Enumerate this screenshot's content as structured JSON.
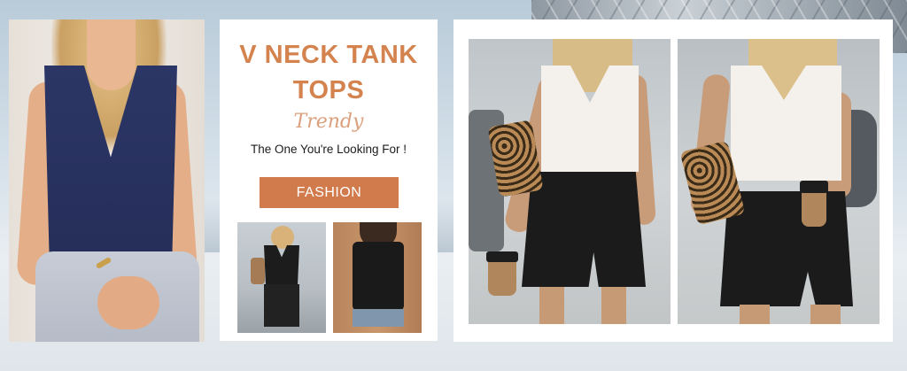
{
  "banner": {
    "title": "V NECK TANK TOPS",
    "script_word": "Trendy",
    "tagline": "The One You're Looking For !",
    "button_label": "FASHION"
  },
  "colors": {
    "accent": "#d4834e",
    "button": "#d17b4c",
    "top_navy": "#2c3666",
    "top_white": "#f4f1ec",
    "top_black": "#1e1e1e",
    "skirt_black": "#1b1b1b"
  },
  "images": [
    {
      "name": "model-navy-tank-photo"
    },
    {
      "name": "thumbnail-black-tank-front"
    },
    {
      "name": "thumbnail-black-tank-back"
    },
    {
      "name": "model-white-tank-street-photo-1"
    },
    {
      "name": "model-white-tank-street-photo-2"
    }
  ]
}
